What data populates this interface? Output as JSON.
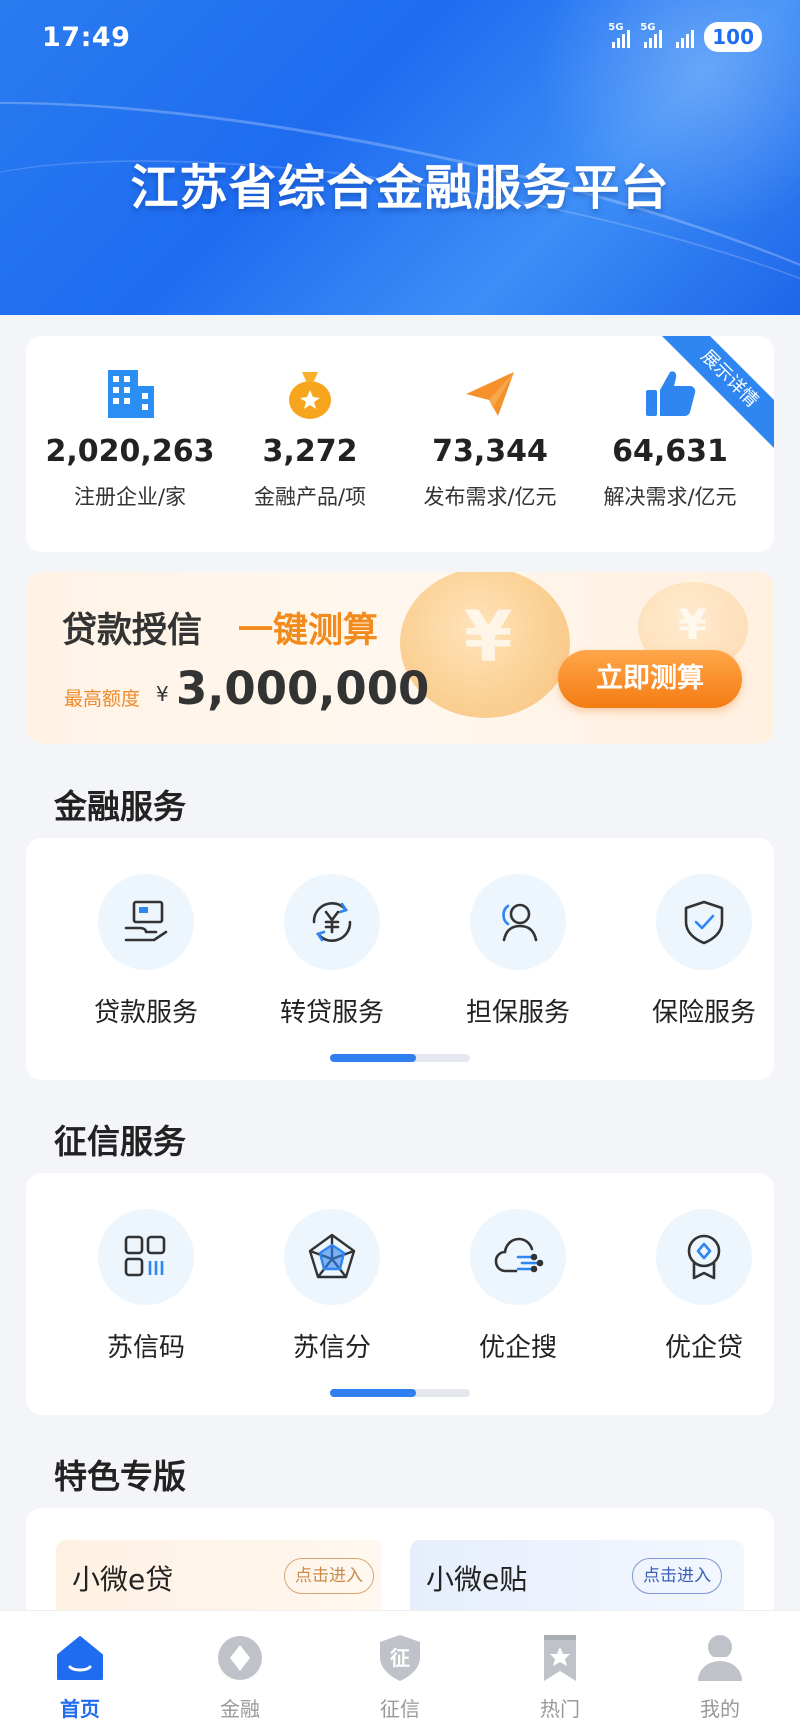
{
  "status_bar": {
    "time": "17:49",
    "signal1": "5G",
    "signal2": "5G",
    "battery": "100"
  },
  "header": {
    "title": "江苏省综合金融服务平台"
  },
  "stats": {
    "ribbon": "展示详情",
    "items": [
      {
        "value": "2,020,263",
        "label": "注册企业/家",
        "icon": "building-icon"
      },
      {
        "value": "3,272",
        "label": "金融产品/项",
        "icon": "money-bag-icon"
      },
      {
        "value": "73,344",
        "label": "发布需求/亿元",
        "icon": "paper-plane-icon"
      },
      {
        "value": "64,631",
        "label": "解决需求/亿元",
        "icon": "thumbs-up-icon"
      }
    ]
  },
  "loan_banner": {
    "title_part1": "贷款授信",
    "title_part2": "一键测算",
    "sub_label": "最高额度",
    "currency": "¥",
    "amount": "3,000,000",
    "button": "立即测算"
  },
  "finance_services": {
    "title": "金融服务",
    "items": [
      {
        "label": "贷款服务",
        "icon": "hand-card-icon"
      },
      {
        "label": "转贷服务",
        "icon": "yuan-cycle-icon"
      },
      {
        "label": "担保服务",
        "icon": "guarantee-person-icon"
      },
      {
        "label": "保险服务",
        "icon": "shield-check-icon"
      }
    ],
    "page_progress": 0.6
  },
  "credit_services": {
    "title": "征信服务",
    "items": [
      {
        "label": "苏信码",
        "icon": "code-grid-icon"
      },
      {
        "label": "苏信分",
        "icon": "radar-chart-icon"
      },
      {
        "label": "优企搜",
        "icon": "cloud-search-icon"
      },
      {
        "label": "优企贷",
        "icon": "badge-icon"
      }
    ],
    "page_progress": 0.6
  },
  "special": {
    "title": "特色专版",
    "items": [
      {
        "label": "小微e贷",
        "button": "点击进入",
        "accent": "#c98a4a"
      },
      {
        "label": "小微e贴",
        "button": "点击进入",
        "accent": "#3a5fb8"
      }
    ]
  },
  "tabbar": {
    "items": [
      {
        "label": "首页",
        "icon": "home-icon",
        "active": true
      },
      {
        "label": "金融",
        "icon": "diamond-icon",
        "active": false
      },
      {
        "label": "征信",
        "icon": "credit-shield-icon",
        "active": false
      },
      {
        "label": "热门",
        "icon": "bookmark-star-icon",
        "active": false
      },
      {
        "label": "我的",
        "icon": "user-icon",
        "active": false
      }
    ]
  },
  "colors": {
    "primary": "#1f6cf0",
    "accent_orange": "#f28a1c",
    "background": "#f3f5f9"
  }
}
